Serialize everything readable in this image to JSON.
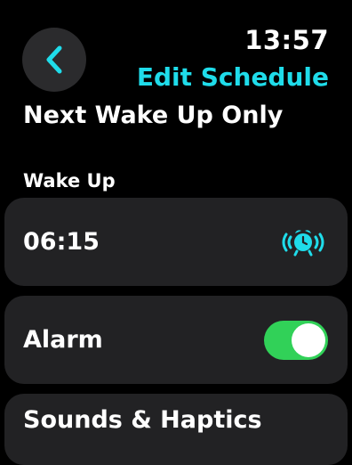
{
  "status": {
    "time": "13:57"
  },
  "header": {
    "title": "Edit Schedule"
  },
  "page": {
    "title": "Next Wake Up Only"
  },
  "wake_up": {
    "section_label": "Wake Up",
    "time": "06:15"
  },
  "alarm": {
    "label": "Alarm",
    "enabled": true
  },
  "sounds": {
    "label": "Sounds & Haptics"
  },
  "colors": {
    "accent": "#1fdcea",
    "toggle_on": "#31d158",
    "card_bg": "#222224",
    "back_button_bg": "#2b2b2d"
  },
  "icons": {
    "back": "chevron-left-icon",
    "alarm": "alarm-clock-icon"
  }
}
